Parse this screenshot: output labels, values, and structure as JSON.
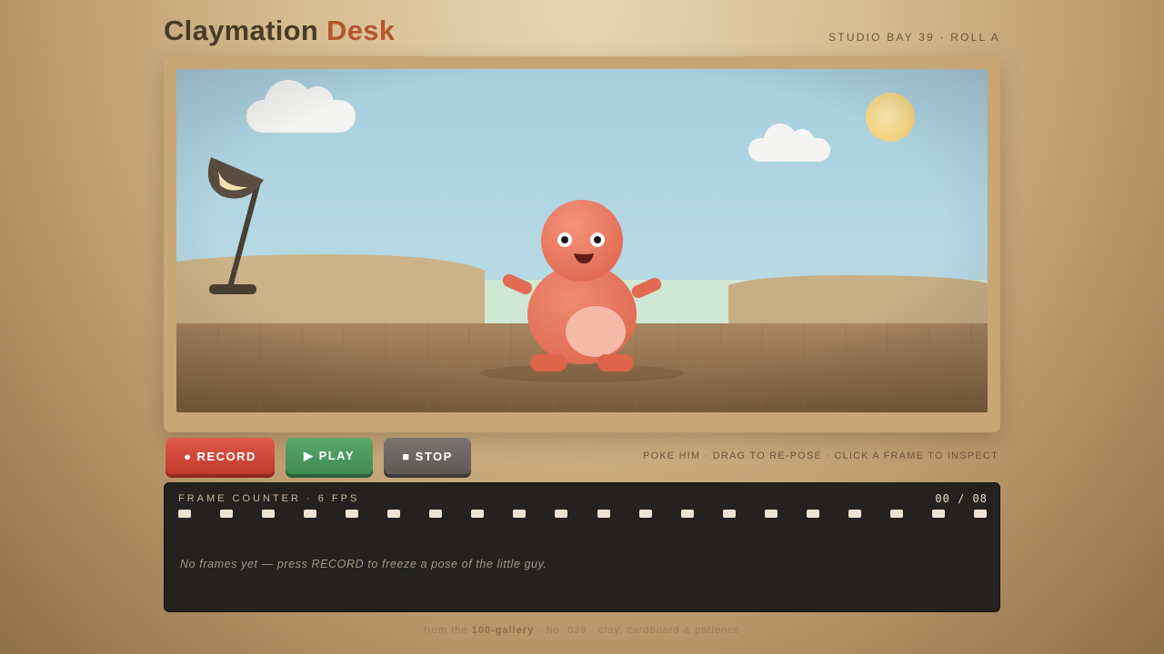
{
  "app": {
    "title_main": "Claymation",
    "title_accent": "Desk",
    "studio_label": "STUDIO BAY 39 · ROLL A"
  },
  "controls": {
    "record_label": "● RECORD",
    "play_label": "▶ PLAY",
    "stop_label": "■ STOP",
    "hint": "POKE HIM · DRAG TO RE-POSE · CLICK A FRAME TO INSPECT"
  },
  "filmstrip": {
    "label": "FRAME COUNTER · 6 FPS",
    "counter": "00 / 08",
    "empty_message": "No frames yet — press RECORD to freeze a pose of the little guy.",
    "sprocket_count": 20
  },
  "footer": {
    "prefix": "from the",
    "gallery": "100-gallery",
    "suffix": "· No. 039 · clay, cardboard & patience"
  },
  "colors": {
    "accent": "#b5562f",
    "record": "#c0392b",
    "play": "#3f8a52",
    "stop": "#5e5955",
    "clay": "#e8705a"
  },
  "scene": {
    "icons": [
      "desk-lamp-icon",
      "cloud-icon",
      "sun-icon",
      "clay-figure"
    ]
  }
}
